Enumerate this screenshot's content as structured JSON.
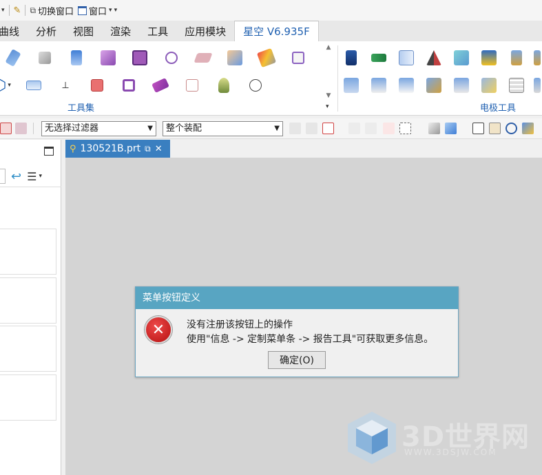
{
  "quick_access": {
    "switch_window": "切换窗口",
    "window": "窗口"
  },
  "menu_tabs": [
    {
      "label": "曲线"
    },
    {
      "label": "分析"
    },
    {
      "label": "视图"
    },
    {
      "label": "渲染"
    },
    {
      "label": "工具"
    },
    {
      "label": "应用模块"
    },
    {
      "label": "星空 V6.935F",
      "active": true
    }
  ],
  "ribbon": {
    "group_tools_label": "工具集",
    "group_electrode_label": "电极工具"
  },
  "toolbar": {
    "filter_value": "无选择过滤器",
    "assembly_value": "整个装配"
  },
  "document": {
    "tab_label": "130521B.prt"
  },
  "dialog": {
    "title": "菜单按钮定义",
    "message_line1": "没有注册该按钮上的操作",
    "message_line2": "使用\"信息 -> 定制菜单条 -> 报告工具\"可获取更多信息。",
    "ok_label": "确定(O)"
  },
  "watermark": {
    "brand": "3D世界网",
    "url": "WWW.3DSJW.COM"
  },
  "colors": {
    "accent": "#1e5fb0",
    "dialog_title_bg": "#58a5c2",
    "doc_tab_bg": "#3a7fc0",
    "error_red": "#c81e1e"
  }
}
